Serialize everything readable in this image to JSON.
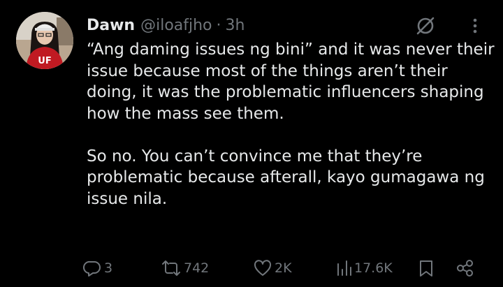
{
  "author": {
    "name": "Dawn",
    "handle": "@iloafjho",
    "separator": "·",
    "time": "3h",
    "avatar_shirt_text": "UF"
  },
  "tweet": {
    "paragraph1": "“Ang daming issues ng bini” and it was never their issue because most of the things aren’t their doing, it was the problematic influencers shaping how the mass see them.",
    "paragraph2": "So no. You can’t convince me  that they’re problematic because afterall, kayo gumagawa ng issue nila."
  },
  "actions": {
    "replies": "3",
    "reposts": "742",
    "likes": "2K",
    "views": "17.6K"
  },
  "icons": [
    "grok-icon",
    "more-icon",
    "reply-icon",
    "repost-icon",
    "like-icon",
    "views-icon",
    "bookmark-icon",
    "share-icon"
  ],
  "colors": {
    "background": "#000000",
    "text": "#e7e9ea",
    "secondary": "#71767b"
  }
}
